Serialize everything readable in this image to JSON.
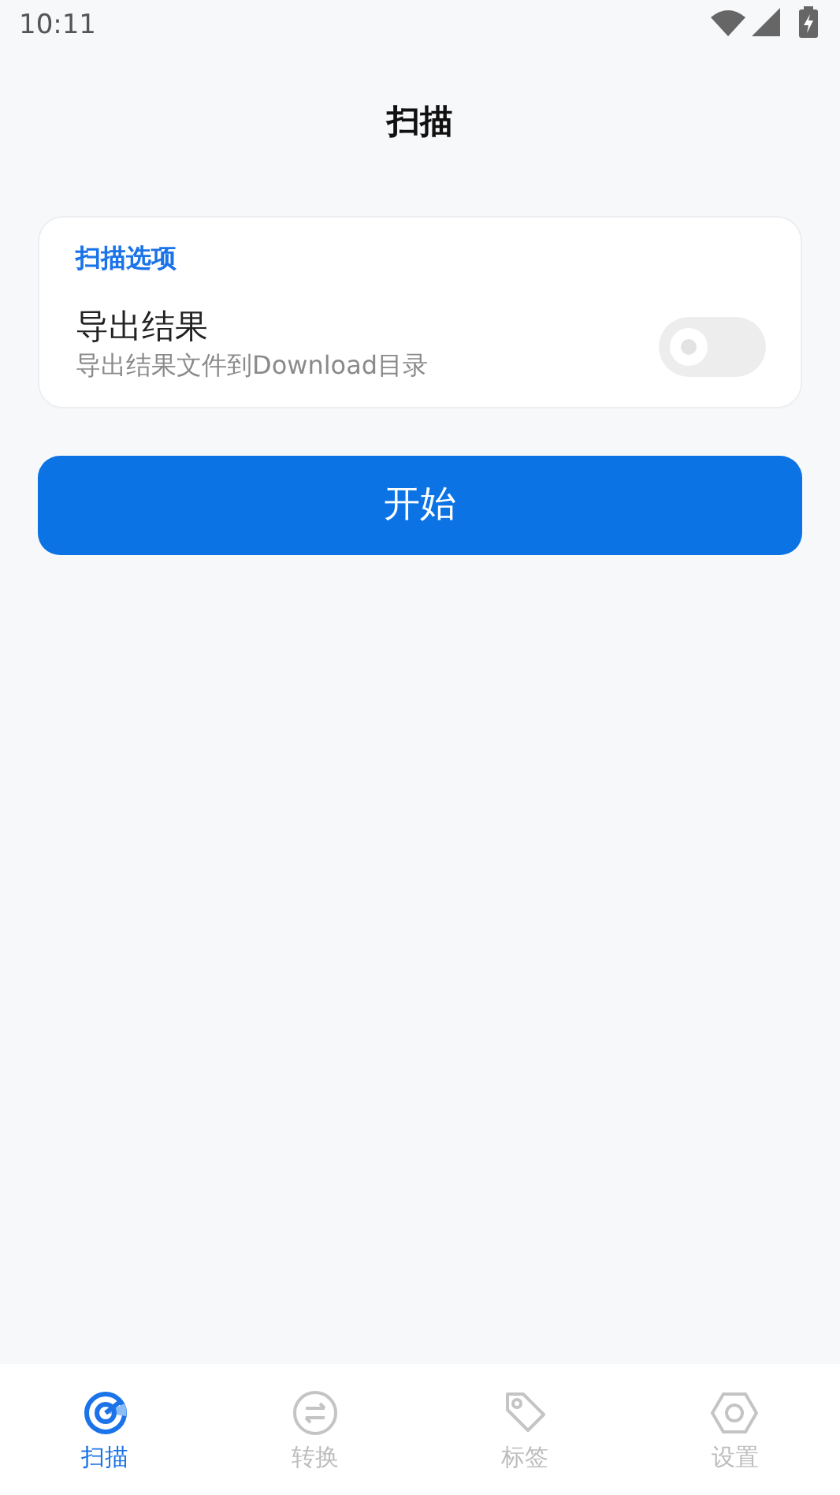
{
  "status_bar": {
    "time": "10:11"
  },
  "header": {
    "title": "扫描"
  },
  "options_card": {
    "heading": "扫描选项",
    "setting": {
      "label": "导出结果",
      "description": "导出结果文件到Download目录",
      "on": false
    }
  },
  "start_button": "开始",
  "bottom_nav": [
    {
      "kind": "scan",
      "label": "扫描",
      "selected": true
    },
    {
      "kind": "convert",
      "label": "转换",
      "selected": false
    },
    {
      "kind": "tag",
      "label": "标签",
      "selected": false
    },
    {
      "kind": "settings",
      "label": "设置",
      "selected": false
    }
  ]
}
